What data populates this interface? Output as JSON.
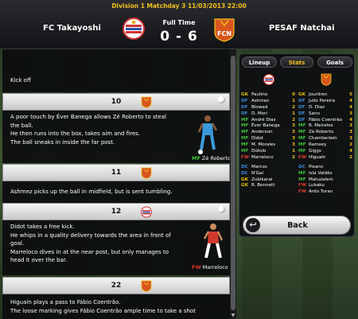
{
  "header": {
    "match_info": "Division 1  Matchday 3  11/03/2013 22:00",
    "home_team": "FC Takayoshi",
    "away_team": "PESAF Natchai",
    "status": "Full Time",
    "score": "0 - 6",
    "home_crest_icon": "takayoshi-crest-icon",
    "away_crest_icon": "fcn-crest-icon",
    "away_crest_text": "FCN"
  },
  "feed": {
    "kickoff": "Kick off",
    "events": [
      {
        "minute": "10",
        "lines": [
          "A poor touch by Éver Banega allows Zé Roberto to steal",
          "the ball.",
          "He then runs into the box, takes aim and fires.",
          "The ball sneaks in inside the far post."
        ],
        "player_pos": "MF",
        "player_name": "Zé Roberto"
      },
      {
        "minute": "11",
        "lines": [
          "Ashmez picks up the ball in midfield, but is sent tumbling."
        ]
      },
      {
        "minute": "12",
        "lines": [
          "Didot takes a free kick.",
          "He whips in a quality delivery towards the area in front of",
          "goal.",
          "Marreloco dives in at the near post, but only manages to",
          "head it over the bar."
        ],
        "player_pos": "FW",
        "player_name": "Marreloco"
      },
      {
        "minute": "22",
        "lines": [
          "Higuaín plays a pass to Fábio Coentrão.",
          "The loose marking gives Fábio Coentrão ample time to take a shot"
        ]
      }
    ]
  },
  "panel": {
    "tabs": [
      "Lineup",
      "Stats",
      "Goals"
    ],
    "active_tab": "Stats",
    "home_players": [
      {
        "pos": "GK",
        "name": "Paulino",
        "rating": "0"
      },
      {
        "pos": "DF",
        "name": "Ashmez",
        "rating": "1"
      },
      {
        "pos": "DF",
        "name": "Blowed",
        "rating": "2"
      },
      {
        "pos": "DF",
        "name": "D. Mori",
        "rating": "1"
      },
      {
        "pos": "MF",
        "name": "André Dias",
        "rating": "2"
      },
      {
        "pos": "MF",
        "name": "Éver Banega",
        "rating": "3"
      },
      {
        "pos": "MF",
        "name": "Anderson",
        "rating": "3"
      },
      {
        "pos": "MF",
        "name": "Didot",
        "rating": "3"
      },
      {
        "pos": "MF",
        "name": "M. Morales",
        "rating": "3"
      },
      {
        "pos": "MF",
        "name": "Dútolo",
        "rating": "1"
      },
      {
        "pos": "FW",
        "name": "Marreloco",
        "rating": "2"
      }
    ],
    "home_subs": [
      {
        "pos": "DC",
        "name": "Marcos"
      },
      {
        "pos": "DC",
        "name": "N'Gal"
      },
      {
        "pos": "GK",
        "name": "Zubikarai"
      },
      {
        "pos": "GK",
        "name": "R. Bennett"
      }
    ],
    "away_players": [
      {
        "pos": "GK",
        "name": "Jourdren",
        "rating": "5"
      },
      {
        "pos": "DF",
        "name": "Julio Pereira",
        "rating": "4"
      },
      {
        "pos": "DF",
        "name": "D. Diaz",
        "rating": "4"
      },
      {
        "pos": "DF",
        "name": "Sano",
        "rating": "3"
      },
      {
        "pos": "DF",
        "name": "Fábio Coentrão",
        "rating": "4"
      },
      {
        "pos": "MF",
        "name": "R. Meireles",
        "rating": "3"
      },
      {
        "pos": "MF",
        "name": "Zé Roberto",
        "rating": "3"
      },
      {
        "pos": "MF",
        "name": "Chamberlain",
        "rating": "3"
      },
      {
        "pos": "MF",
        "name": "Ramsey",
        "rating": "2"
      },
      {
        "pos": "MF",
        "name": "Giggs",
        "rating": "4"
      },
      {
        "pos": "FW",
        "name": "Higuaín",
        "rating": "2"
      }
    ],
    "away_subs": [
      {
        "pos": "DC",
        "name": "Pisano"
      },
      {
        "pos": "MF",
        "name": "Isla Valdés"
      },
      {
        "pos": "MF",
        "name": "Matuzalem"
      },
      {
        "pos": "FW",
        "name": "Lukaku"
      },
      {
        "pos": "FW",
        "name": "Ardo Turan"
      }
    ],
    "back_label": "Back"
  },
  "colors": {
    "accent_yellow": "#f2c11e",
    "mf_green": "#3ec23e",
    "df_blue": "#3a8bdc",
    "fw_red": "#e03a2e"
  }
}
